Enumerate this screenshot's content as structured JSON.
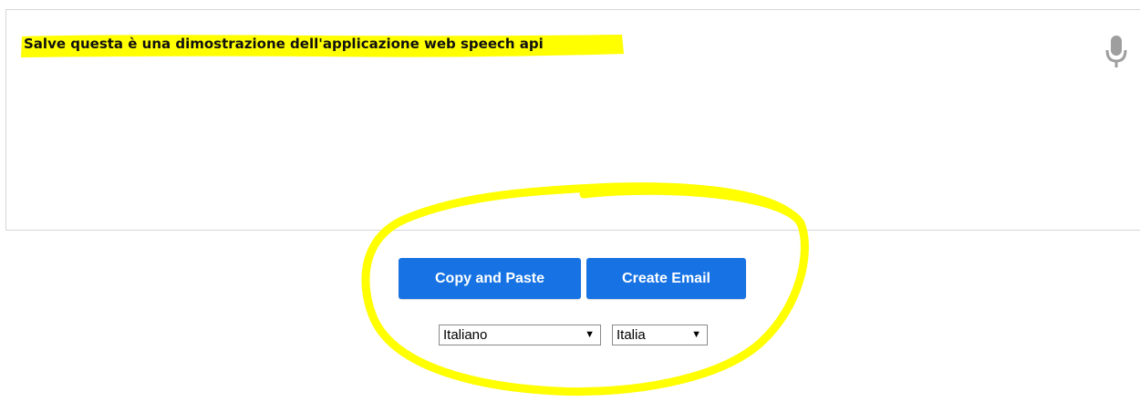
{
  "transcript": {
    "text": "Salve questa è una dimostrazione dell'applicazione web speech api"
  },
  "mic": {
    "icon": "microphone-icon"
  },
  "actions": {
    "copy_label": "Copy and Paste",
    "email_label": "Create Email"
  },
  "language_select": {
    "selected": "Italiano"
  },
  "dialect_select": {
    "selected": "Italia"
  },
  "colors": {
    "button_blue": "#1773e3",
    "highlight_yellow": "#ffff00",
    "box_border": "#d6d6d6"
  }
}
